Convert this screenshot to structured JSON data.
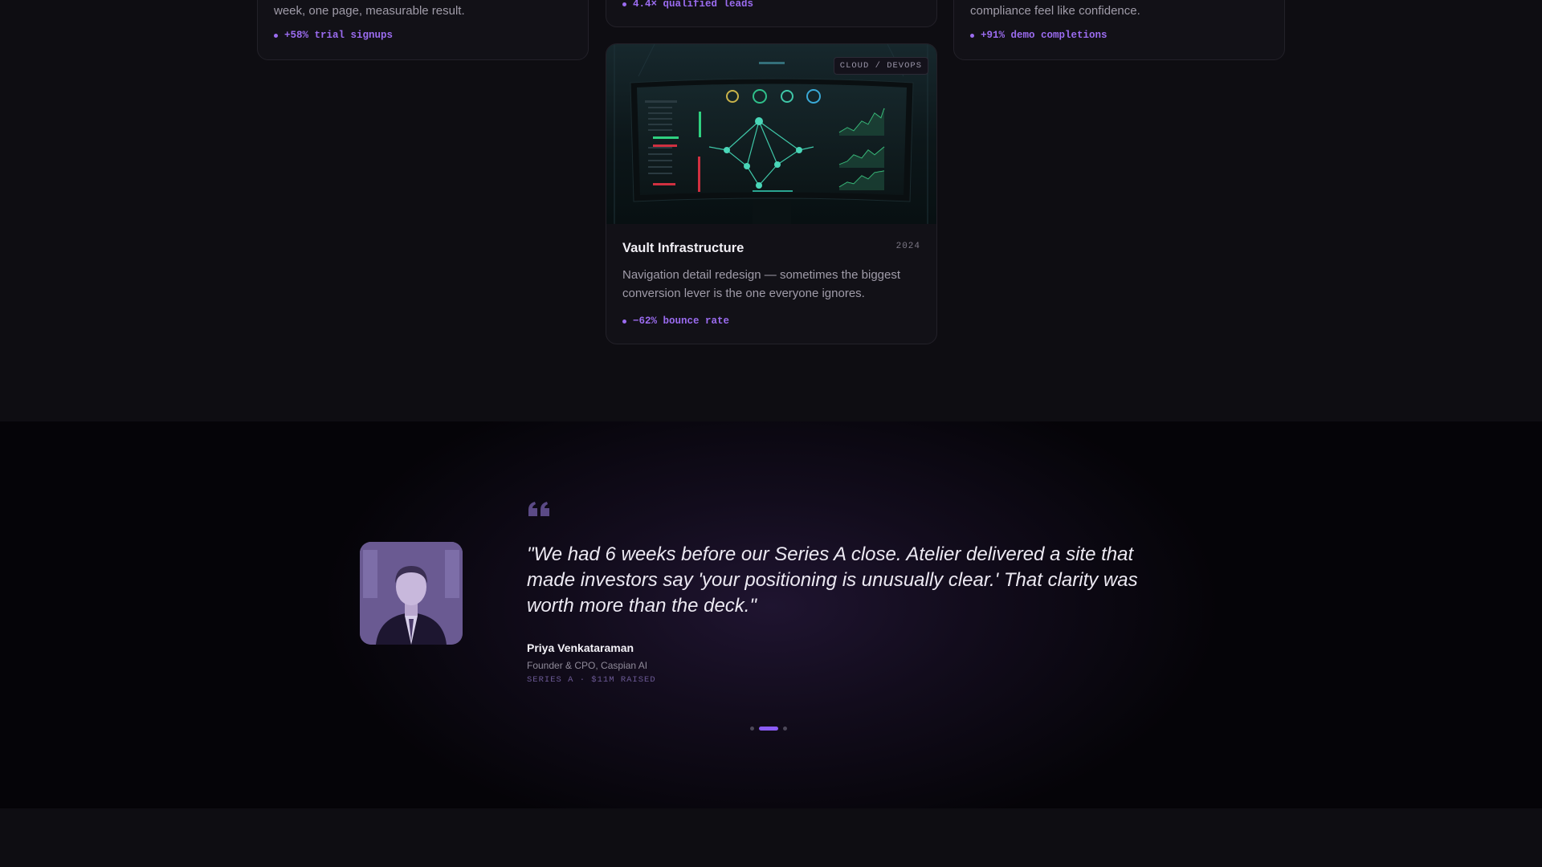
{
  "cards": {
    "left": {
      "description": "week, one page, measurable result.",
      "metric": "+58% trial signups"
    },
    "middle_top": {
      "metric": "4.4× qualified leads"
    },
    "right": {
      "description": "compliance feel like confidence.",
      "metric": "+91% demo completions"
    },
    "main": {
      "tag": "CLOUD / DEVOPS",
      "title": "Vault Infrastructure",
      "year": "2024",
      "description": "Navigation detail redesign — sometimes the biggest conversion lever is the one everyone ignores.",
      "metric": "−62% bounce rate"
    }
  },
  "testimonial": {
    "quote": "\"We had 6 weeks before our Series A close. Atelier delivered a site that made investors say 'your positioning is unusually clear.' That clarity was worth more than the deck.\"",
    "author_name": "Priya Venkataraman",
    "author_role": "Founder & CPO, Caspian AI",
    "author_meta": "SERIES A · $11M RAISED",
    "carousel": {
      "count": 3,
      "active_index": 1
    }
  },
  "colors": {
    "accent": "#8b5cf6",
    "background": "#0e0d12",
    "card": "#121117"
  },
  "icons": {
    "quote": "quote-mark-icon",
    "avatar": "avatar-photo"
  }
}
